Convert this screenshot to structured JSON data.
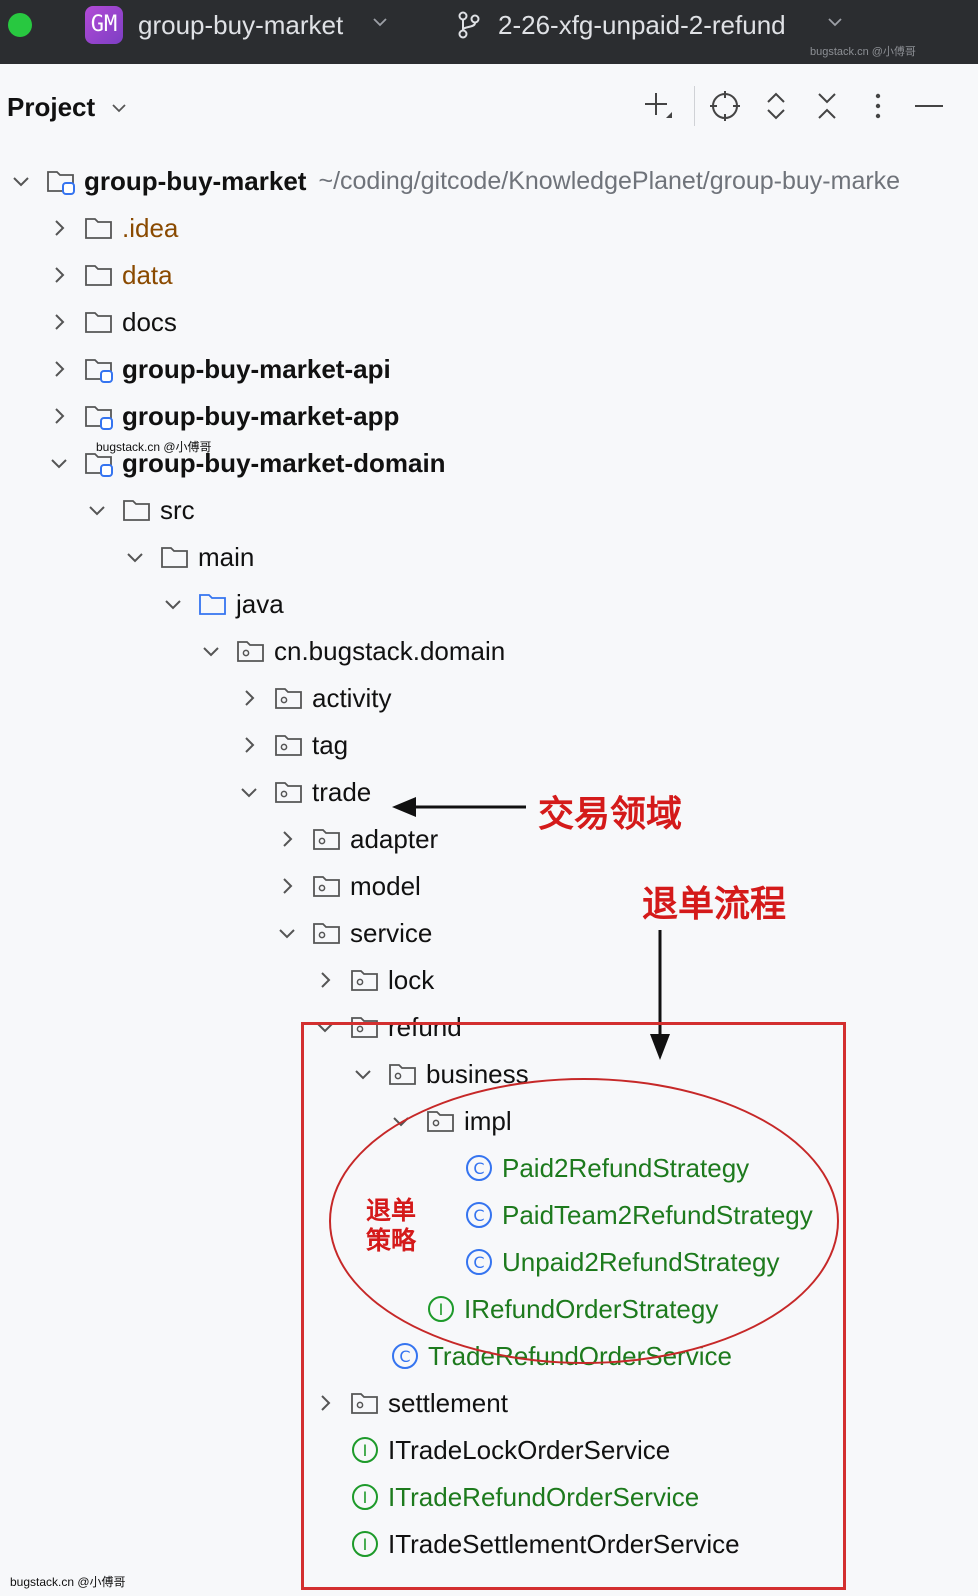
{
  "titlebar": {
    "project_badge": "GM",
    "project_name": "group-buy-market",
    "branch_name": "2-26-xfg-unpaid-2-refund",
    "watermark": "bugstack.cn @小傅哥"
  },
  "panel": {
    "title": "Project",
    "tools": [
      "add-icon",
      "locate-icon",
      "expand-all-icon",
      "collapse-all-icon",
      "more-icon",
      "hide-icon"
    ]
  },
  "tree": {
    "root": {
      "label": "group-buy-market",
      "path": "~/coding/gitcode/KnowledgePlanet/group-buy-marke"
    },
    "idea": ".idea",
    "data": "data",
    "docs": "docs",
    "api": "group-buy-market-api",
    "app": "group-buy-market-app",
    "domain": "group-buy-market-domain",
    "src": "src",
    "main": "main",
    "java": "java",
    "pkg": "cn.bugstack.domain",
    "activity": "activity",
    "tag": "tag",
    "trade": "trade",
    "adapter": "adapter",
    "model": "model",
    "service": "service",
    "lock": "lock",
    "refund": "refund",
    "business": "business",
    "impl": "impl",
    "paid2refund": "Paid2RefundStrategy",
    "paidteam2refund": "PaidTeam2RefundStrategy",
    "unpaid2refund": "Unpaid2RefundStrategy",
    "irefundorder": "IRefundOrderStrategy",
    "traderefundorderservice": "TradeRefundOrderService",
    "settlement": "settlement",
    "itradelock": "ITradeLockOrderService",
    "itraderefund": "ITradeRefundOrderService",
    "itradesettlement": "ITradeSettlementOrderService"
  },
  "annotations": {
    "trade_domain": "交易领域",
    "refund_flow": "退单流程",
    "refund_strategy_line1": "退单",
    "refund_strategy_line2": "策略",
    "watermark_mid": "bugstack.cn @小傅哥",
    "watermark_bottom": "bugstack.cn @小傅哥"
  },
  "colors": {
    "titlebar_bg": "#2b2d30",
    "panel_bg": "#f7f8fa",
    "annotation_red": "#d41a1a",
    "class_green": "#1d7a1d",
    "folder_brown": "#8a4a00",
    "class_icon_blue": "#3574f0"
  }
}
